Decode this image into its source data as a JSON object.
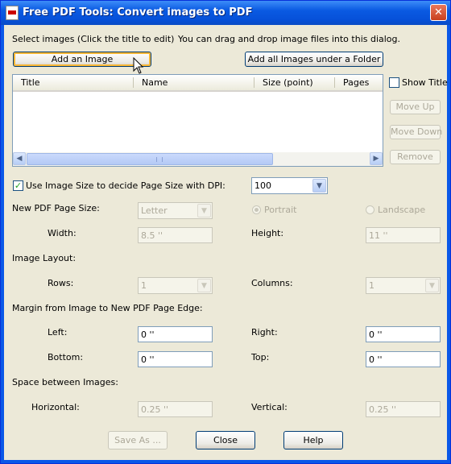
{
  "window": {
    "title": "Free PDF Tools: Convert images to PDF",
    "close_glyph": "✕"
  },
  "top": {
    "select_label": "Select images (Click the title to edit)",
    "hint": "You can drag and drop image files into this dialog.",
    "add_image": "Add an Image",
    "add_folder": "Add all Images under a Folder"
  },
  "table": {
    "columns": [
      "Title",
      "Name",
      "Size (point)",
      "Pages"
    ],
    "rows": []
  },
  "side": {
    "show_title": "Show Title",
    "move_up": "Move Up",
    "move_down": "Move Down",
    "remove": "Remove"
  },
  "dpi": {
    "label": "Use Image Size to decide Page Size with DPI:",
    "checked": true,
    "value": "100"
  },
  "page_size": {
    "label": "New PDF Page Size:",
    "value": "Letter",
    "portrait": "Portrait",
    "landscape": "Landscape",
    "width_label": "Width:",
    "width": "8.5 ''",
    "height_label": "Height:",
    "height": "11 ''"
  },
  "layout": {
    "label": "Image Layout:",
    "rows_label": "Rows:",
    "rows": "1",
    "columns_label": "Columns:",
    "columns": "1"
  },
  "margin": {
    "label": "Margin from Image to New PDF Page Edge:",
    "left_label": "Left:",
    "left": "0 ''",
    "right_label": "Right:",
    "right": "0 ''",
    "bottom_label": "Bottom:",
    "bottom": "0 ''",
    "top_label": "Top:",
    "top": "0 ''"
  },
  "spacing": {
    "label": "Space between Images:",
    "horizontal_label": "Horizontal:",
    "horizontal": "0.25 ''",
    "vertical_label": "Vertical:",
    "vertical": "0.25 ''"
  },
  "footer": {
    "save_as": "Save As ...",
    "close": "Close",
    "help": "Help"
  }
}
